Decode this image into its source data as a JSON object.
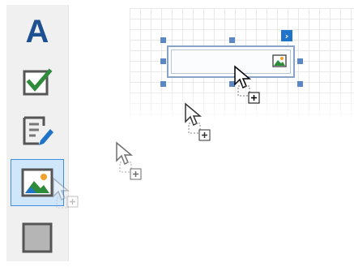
{
  "toolbox": {
    "items": [
      {
        "name": "label",
        "glyph": "A",
        "icon": "label-icon"
      },
      {
        "name": "checkbox",
        "icon": "checkbox-icon"
      },
      {
        "name": "rich-text",
        "icon": "rich-text-icon"
      },
      {
        "name": "picture-box",
        "icon": "picture-box-icon",
        "selected": true
      },
      {
        "name": "panel",
        "icon": "panel-icon"
      }
    ]
  },
  "designer": {
    "smart_tag_glyph": "›",
    "picture_box_icon": "picture-icon"
  },
  "colors": {
    "label_blue": "#1d4f91",
    "check_green": "#2e8b3a",
    "selection_blue": "#3c8ee6",
    "handle_blue": "#5b87c4",
    "smart_tag_blue": "#1f73c9"
  },
  "drag_cursors": [
    "drag-copy-cursor",
    "drag-copy-cursor",
    "drag-copy-cursor",
    "drag-copy-cursor"
  ]
}
